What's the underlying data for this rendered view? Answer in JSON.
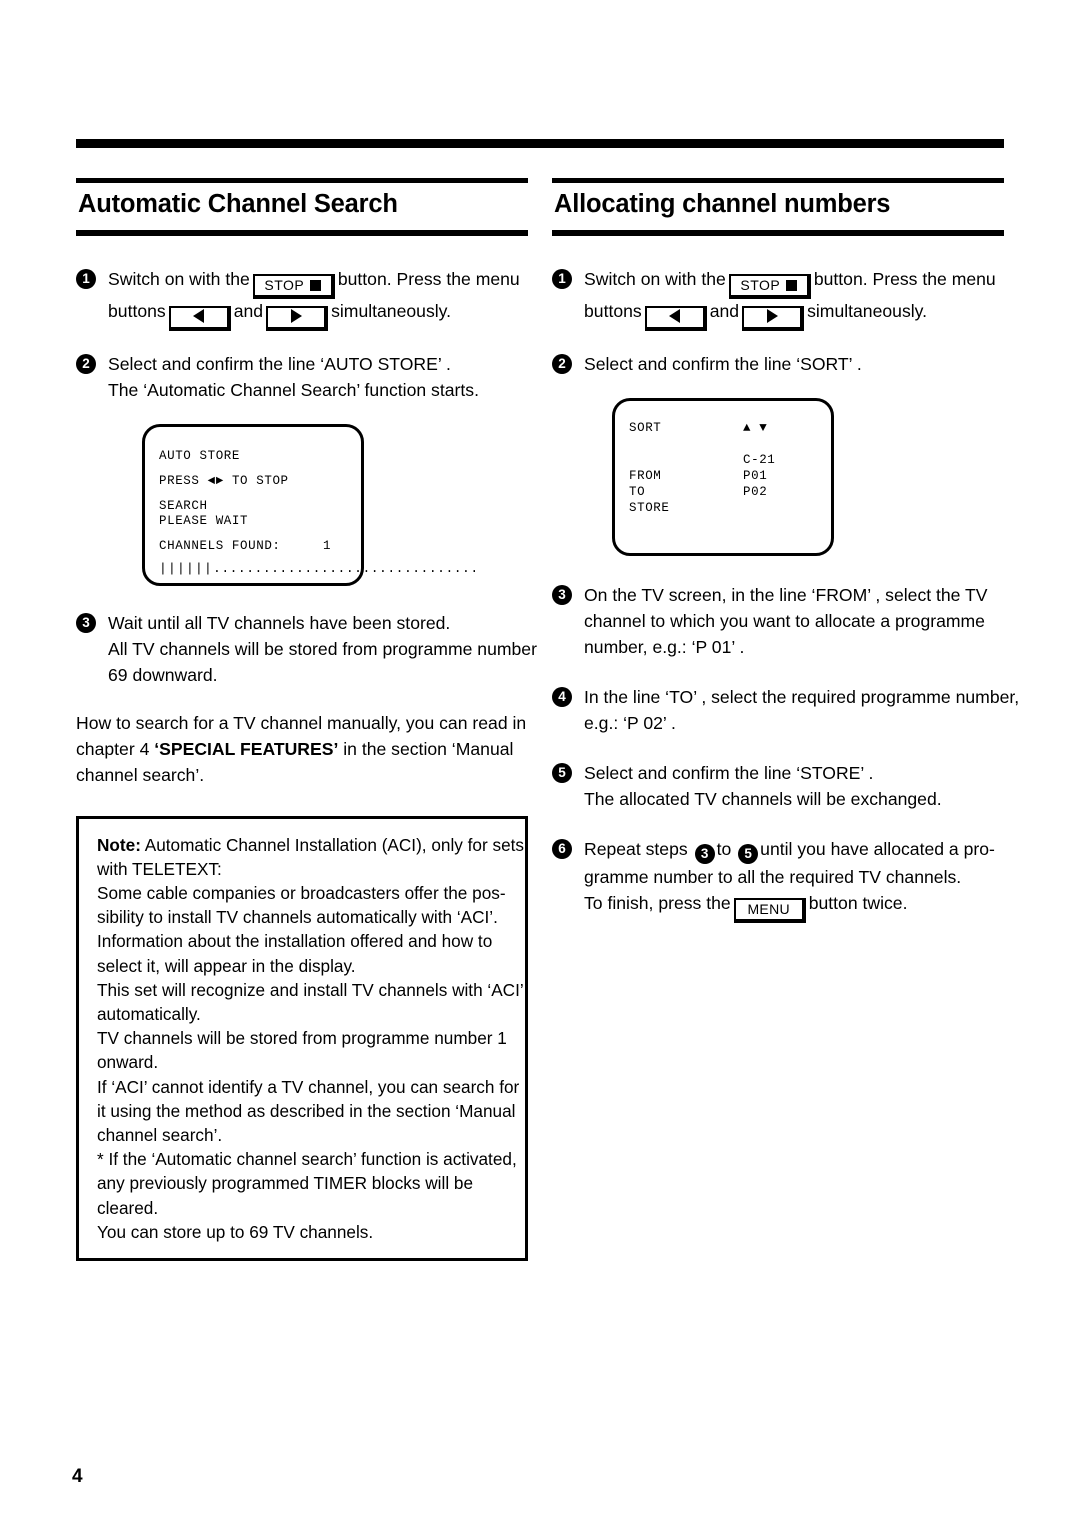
{
  "page": {
    "number": "4"
  },
  "columns": {
    "left": {
      "heading": "Automatic Channel Search",
      "steps": [
        {
          "num": "1",
          "line1_a": "Switch on with the",
          "key_stop": "STOP",
          "line1_b": "button. Press the menu",
          "line2_a": "buttons",
          "line2_b": "and",
          "line2_c": "simultaneously."
        },
        {
          "num": "2",
          "line1": "Select and confirm the line ‘AUTO STORE’ .",
          "line2": "The ‘Automatic Channel Search’ function starts."
        },
        {
          "num": "3",
          "line1": "Wait until all TV channels have been stored.",
          "line2": "All TV channels will be stored from programme number",
          "line3": "69 downward."
        }
      ],
      "screen": {
        "title": "AUTO STORE",
        "press_a": "PRESS",
        "press_b": "TO STOP",
        "search": "SEARCH",
        "please_wait": "PLEASE WAIT",
        "channels_found_label": "CHANNELS FOUND:",
        "channels_found_value": "1",
        "progress_filled": "||||||",
        "progress_empty": "................................"
      },
      "paragraph": {
        "line1": "How to search for a TV channel manually, you can read in",
        "line2_a": "chapter 4 ",
        "line2_bold": "‘SPECIAL FEATURES’",
        "line2_b": " in the section ‘Manual",
        "line3": "channel search’."
      },
      "note": {
        "label": "Note:",
        "line1_rest": " Automatic Channel Installation (ACI), only for sets",
        "lines": [
          "with TELETEXT:",
          "Some cable companies or broadcasters offer the pos-",
          "sibility to install TV channels automatically with ‘ACI’.",
          "Information about the installation offered and how to",
          "select it, will appear in the display.",
          "This set will recognize and install TV channels with ‘ACI’",
          "automatically.",
          "TV channels will be stored from programme number 1",
          "onward.",
          "If ‘ACI’ cannot identify a TV channel, you can search for",
          "it using the method as described in the section ‘Manual",
          "channel search’.",
          "* If the ‘Automatic channel search’ function is activated,",
          "any previously programmed TIMER blocks will be",
          "cleared.",
          "You can store up to 69 TV channels."
        ]
      }
    },
    "right": {
      "heading": "Allocating channel numbers",
      "steps": [
        {
          "num": "1",
          "line1_a": "Switch on with the",
          "key_stop": "STOP",
          "line1_b": "button. Press the menu",
          "line2_a": "buttons",
          "line2_b": "and",
          "line2_c": "simultaneously."
        },
        {
          "num": "2",
          "line1": "Select and confirm the line ‘SORT’ ."
        },
        {
          "num": "3",
          "line1": "On the TV screen, in the line ‘FROM’ , select the TV",
          "line2": "channel to which you want to allocate a programme",
          "line3": "number, e.g.: ‘P 01’ ."
        },
        {
          "num": "4",
          "line1": "In the line ‘TO’ , select the required programme number,",
          "line2": "e.g.: ‘P 02’ ."
        },
        {
          "num": "5",
          "line1": "Select and confirm the line ‘STORE’ .",
          "line2": "The allocated TV channels will be exchanged."
        },
        {
          "num": "6",
          "line1_a": "Repeat steps",
          "ref_from": "3",
          "line1_b": "to",
          "ref_to": "5",
          "line1_c": "until you have allocated a pro-",
          "line2": "gramme number to all the required TV channels.",
          "line3_a": "To finish, press the",
          "key_menu": "MENU",
          "line3_b": "button twice."
        }
      ],
      "screen": {
        "title": "SORT",
        "channel": "C-21",
        "from_label": "FROM",
        "from_value": "P01",
        "to_label": "TO",
        "to_value": "P02",
        "store_label": "STORE"
      }
    }
  }
}
